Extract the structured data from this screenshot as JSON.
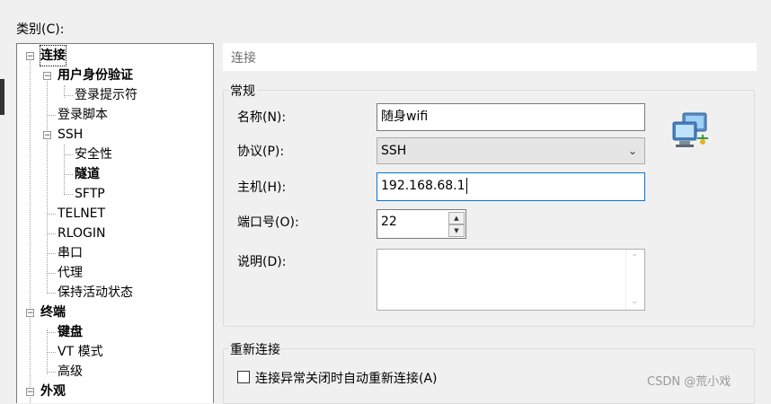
{
  "category_label": "类别(C):",
  "top_fragment": "—",
  "tree": {
    "items": [
      {
        "label": "连接",
        "bold": true,
        "selected": true,
        "toggle": "−"
      },
      {
        "label": "用户身份验证",
        "bold": true,
        "toggle": "−"
      },
      {
        "label": "登录提示符",
        "bold": false
      },
      {
        "label": "登录脚本",
        "bold": false
      },
      {
        "label": "SSH",
        "bold": false,
        "toggle": "−"
      },
      {
        "label": "安全性",
        "bold": false
      },
      {
        "label": "隧道",
        "bold": true
      },
      {
        "label": "SFTP",
        "bold": false
      },
      {
        "label": "TELNET",
        "bold": false
      },
      {
        "label": "RLOGIN",
        "bold": false
      },
      {
        "label": "串口",
        "bold": false
      },
      {
        "label": "代理",
        "bold": false
      },
      {
        "label": "保持活动状态",
        "bold": false
      },
      {
        "label": "终端",
        "bold": true,
        "toggle": "−"
      },
      {
        "label": "键盘",
        "bold": true
      },
      {
        "label": "VT 模式",
        "bold": false
      },
      {
        "label": "高级",
        "bold": false
      },
      {
        "label": "外观",
        "bold": true,
        "toggle": "−"
      }
    ]
  },
  "header": {
    "title": "连接"
  },
  "general": {
    "title": "常规",
    "name_label": "名称(N):",
    "name_value": "随身wifi",
    "protocol_label": "协议(P):",
    "protocol_value": "SSH",
    "host_label": "主机(H):",
    "host_value": "192.168.68.1",
    "port_label": "端口号(O):",
    "port_value": "22",
    "desc_label": "说明(D):",
    "desc_value": ""
  },
  "reconnect": {
    "title": "重新连接",
    "checkbox_label": "连接异常关闭时自动重新连接(A)",
    "checked": false
  },
  "watermark": "CSDN @荒小戏",
  "icons": {
    "computer": "network-computers-icon"
  }
}
